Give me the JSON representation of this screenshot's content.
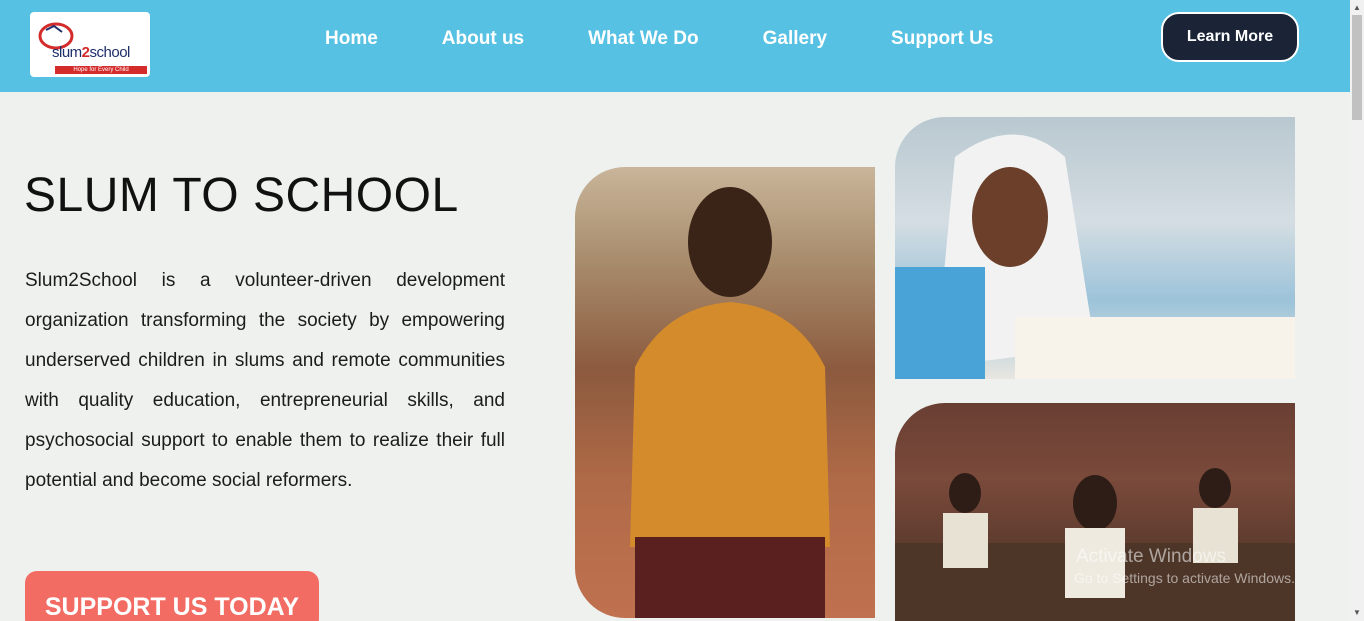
{
  "nav": {
    "logo": {
      "wordmark_a": "slum",
      "wordmark_b": "2",
      "wordmark_c": "school",
      "tagline": "Hope for Every Child"
    },
    "links": [
      "Home",
      "About us",
      "What We Do",
      "Gallery",
      "Support Us"
    ],
    "cta_label": "Learn More"
  },
  "hero": {
    "title": "SLUM TO SCHOOL",
    "description": "Slum2School is a volunteer-driven development organization transforming the society by empowering underserved children in slums and remote communities with quality education, entrepreneurial skills, and psychosocial support to enable them to realize their full potential and become social reformers.",
    "button_label": "SUPPORT US TODAY"
  },
  "images": [
    "photo-of-boy-in-uniform",
    "photo-of-girl-in-hijab-classroom",
    "photo-of-classroom-students"
  ],
  "overlay": {
    "title": "Activate Windows",
    "subtitle": "Go to Settings to activate Windows."
  },
  "colors": {
    "nav_bg": "#56c1e3",
    "page_bg": "#eef1ee",
    "cta_bg": "#f26c63",
    "learn_more_bg": "#1b2336"
  }
}
